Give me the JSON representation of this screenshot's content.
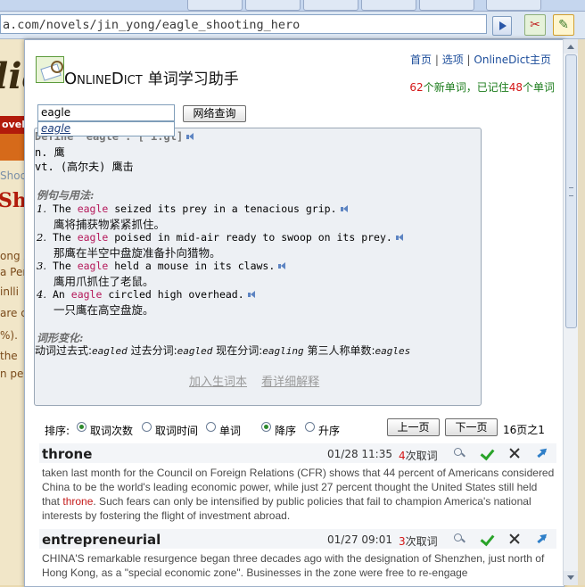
{
  "browser": {
    "url": "a.com/novels/jin_yong/eagle_shooting_hero",
    "go_label": "go"
  },
  "site": {
    "logo": "lia",
    "nav": "ovels",
    "crumb": "Shoo",
    "heading": "Sho",
    "lines": [
      "ong Z",
      "a Per",
      "inlli",
      "are c",
      "%).",
      "the",
      "n per"
    ]
  },
  "header": {
    "brand_part1": "O",
    "brand_part2": "NLINE",
    "brand_part3": "D",
    "brand_part4": "ICT",
    "brand_cn": "单词学习助手",
    "links": [
      "首页",
      "选项",
      "OnlineDict主页"
    ],
    "stats": {
      "new_count": "62",
      "new_label": "个新单词，已记住",
      "known_count": "48",
      "known_label": "个单词"
    }
  },
  "search": {
    "value": "eagle",
    "button": "网络查询",
    "suggestion": "eagle"
  },
  "definition": {
    "headword_line": "Define \"eagle\": [ˈi:gl]",
    "senses": [
      "n. 鹰",
      "vt. (高尔夫) 鹰击"
    ],
    "examples_title": "例句与用法:",
    "examples": [
      {
        "n": "1.",
        "pre": "The ",
        "kw": "eagle",
        "post": " seized its prey in a tenacious grip.",
        "zh": "鹰将捕获物紧紧抓住。"
      },
      {
        "n": "2.",
        "pre": "The ",
        "kw": "eagle",
        "post": " poised in mid-air ready to swoop on its prey.",
        "zh": "那鹰在半空中盘旋准备扑向猎物。"
      },
      {
        "n": "3.",
        "pre": "The ",
        "kw": "eagle",
        "post": " held a mouse in its claws.",
        "zh": "鹰用爪抓住了老鼠。"
      },
      {
        "n": "4.",
        "pre": "An ",
        "kw": "eagle",
        "post": " circled high overhead.",
        "zh": "一只鹰在高空盘旋。"
      }
    ],
    "forms_title": "词形变化:",
    "forms": [
      {
        "label": "动词过去式:",
        "value": "eagled"
      },
      {
        "label": " 过去分词:",
        "value": "eagled"
      },
      {
        "label": " 现在分词:",
        "value": "eagling"
      },
      {
        "label": " 第三人称单数:",
        "value": "eagles"
      }
    ],
    "add_label": "加入生词本",
    "detail_label": "看详细解释"
  },
  "sortbar": {
    "label": "排序:",
    "opt_count": "取词次数",
    "opt_time": "取词时间",
    "opt_word": "单词",
    "opt_desc": "降序",
    "opt_asc": "升序",
    "prev": "上一页",
    "next": "下一页",
    "page_info": "16页之1"
  },
  "entries": [
    {
      "word": "throne",
      "date": "01/28 11:35",
      "count": "4",
      "count_suffix": "次取词",
      "text_pre": "taken last month for the Council on Foreign Relations (CFR) shows that 44 percent of Americans considered China to be the world's leading economic power, while just 27 percent thought the United States still held that ",
      "text_kw": "throne",
      "text_post": ". Such fears can only be intensified by public policies that fail to champion America's national interests by fostering the flight of investment abroad."
    },
    {
      "word": "entrepreneurial",
      "date": "01/27 09:01",
      "count": "3",
      "count_suffix": "次取词",
      "text_pre": "CHINA'S remarkable resurgence began three decades ago with the designation of Shenzhen, just north of Hong Kong, as a \"special economic zone\". Businesses in the zone were free to re-engage",
      "text_kw": "",
      "text_post": ""
    }
  ]
}
